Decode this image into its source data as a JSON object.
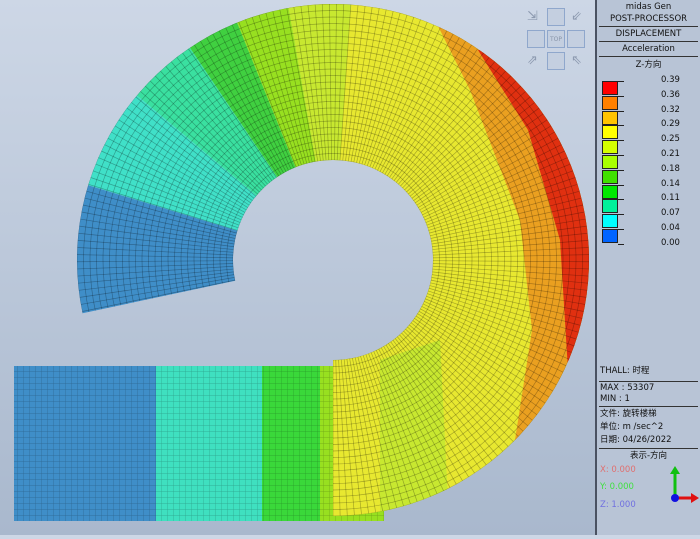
{
  "panel": {
    "app": "midas Gen",
    "module": "POST-PROCESSOR",
    "result_type": "DISPLACEMENT",
    "component": "Acceleration",
    "direction": "Z-方向",
    "legend": [
      {
        "value": "0.39",
        "color": "#ff0000"
      },
      {
        "value": "0.36",
        "color": "#ff8000"
      },
      {
        "value": "0.32",
        "color": "#ffc400"
      },
      {
        "value": "0.29",
        "color": "#ffff00"
      },
      {
        "value": "0.25",
        "color": "#d4ff00"
      },
      {
        "value": "0.21",
        "color": "#a8ff00"
      },
      {
        "value": "0.18",
        "color": "#40e000"
      },
      {
        "value": "0.14",
        "color": "#00e800"
      },
      {
        "value": "0.11",
        "color": "#00f09a"
      },
      {
        "value": "0.07",
        "color": "#00ffff"
      },
      {
        "value": "0.04",
        "color": "#0064ff"
      },
      {
        "value": "0.00",
        "color": ""
      }
    ],
    "load_case": "THALL: 时程",
    "max": "MAX : 53307",
    "min": "MIN : 1",
    "file": "文件: 旋转楼梯",
    "unit": "单位: m /sec^2",
    "date": "日期: 04/26/2022",
    "view_dir_label": "表示-方向",
    "x": "X: 0.000",
    "y": "Y: 0.000",
    "z": "Z: 1.000",
    "x_color": "#e07070",
    "y_color": "#40e040",
    "z_color": "#7070e0"
  },
  "view_cube": {
    "top_label": "TOP"
  }
}
